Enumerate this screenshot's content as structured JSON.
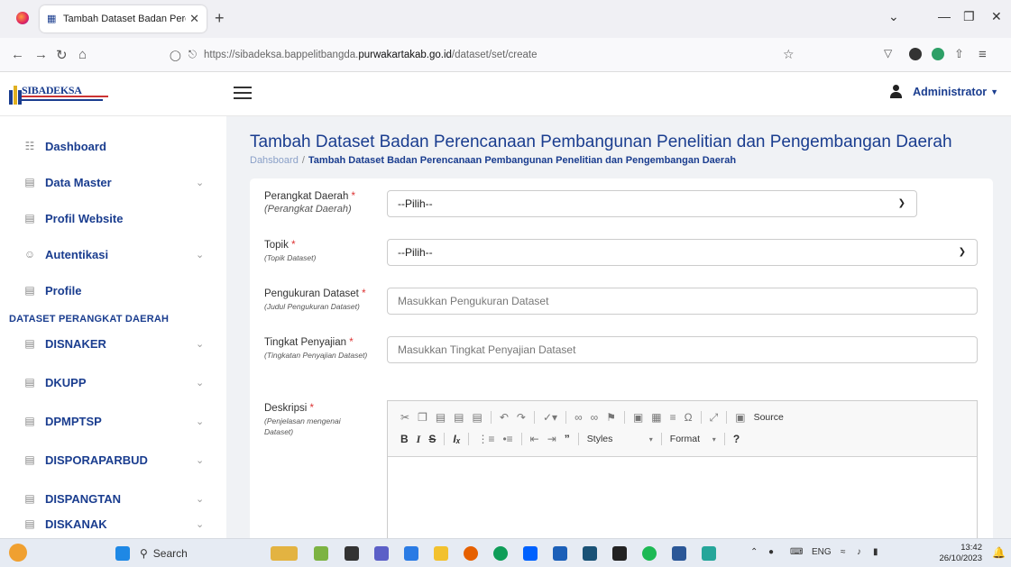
{
  "browser": {
    "tab_title": "Tambah Dataset Badan Perenca",
    "url_prefix": "https://sibadeksa.bappelitbangda.",
    "url_domain": "purwakartakab.go.id",
    "url_path": "/dataset/set/create"
  },
  "header": {
    "brand": "SIBADEKSA",
    "user": "Administrator"
  },
  "sidebar": {
    "items": [
      {
        "label": "Dashboard",
        "icon": "dashboard-icon",
        "glyph": "☷",
        "chevron": false
      },
      {
        "label": "Data Master",
        "icon": "database-icon",
        "glyph": "☷",
        "chevron": true
      },
      {
        "label": "Profil Website",
        "icon": "building-icon",
        "glyph": "▤",
        "chevron": false
      },
      {
        "label": "Autentikasi",
        "icon": "users-icon",
        "glyph": "☺",
        "chevron": true
      },
      {
        "label": "Profile",
        "icon": "id-card-icon",
        "glyph": "▤",
        "chevron": false
      }
    ],
    "heading": "DATASET PERANGKAT DAERAH",
    "datasets": [
      {
        "label": "DISNAKER"
      },
      {
        "label": "DKUPP"
      },
      {
        "label": "DPMPTSP"
      },
      {
        "label": "DISPORAPARBUD"
      },
      {
        "label": "DISPANGTAN"
      },
      {
        "label": "DISKANAK"
      }
    ]
  },
  "main": {
    "title": "Tambah Dataset Badan Perencanaan Pembangunan Penelitian dan Pengembangan Daerah",
    "breadcrumb_home": "Dahsboard",
    "breadcrumb_sep": "/",
    "breadcrumb_current": "Tambah Dataset Badan Perencanaan Pembangunan Penelitian dan Pengembangan Daerah"
  },
  "form": {
    "perangkat": {
      "label": "Perangkat Daerah",
      "hint": "(Perangkat Daerah)",
      "value": "--Pilih--"
    },
    "topik": {
      "label": "Topik",
      "hint": "(Topik Dataset)",
      "value": "--Pilih--"
    },
    "pengukuran": {
      "label": "Pengukuran Dataset",
      "hint": "(Judul Pengukuran Dataset)",
      "placeholder": "Masukkan Pengukuran Dataset"
    },
    "tingkat": {
      "label": "Tingkat Penyajian",
      "hint": "(Tingkatan Penyajian Dataset)",
      "placeholder": "Masukkan Tingkat Penyajian Dataset"
    },
    "deskripsi": {
      "label": "Deskripsi",
      "hint": "(Penjelasan mengenai Dataset)"
    },
    "required_mark": "*"
  },
  "editor": {
    "source_label": "Source",
    "styles_label": "Styles",
    "format_label": "Format"
  },
  "taskbar": {
    "search": "Search",
    "lang": "ENG",
    "time": "13:42",
    "date": "26/10/2023"
  },
  "colors": {
    "brand": "#1a3d8f",
    "required": "#d33333"
  }
}
